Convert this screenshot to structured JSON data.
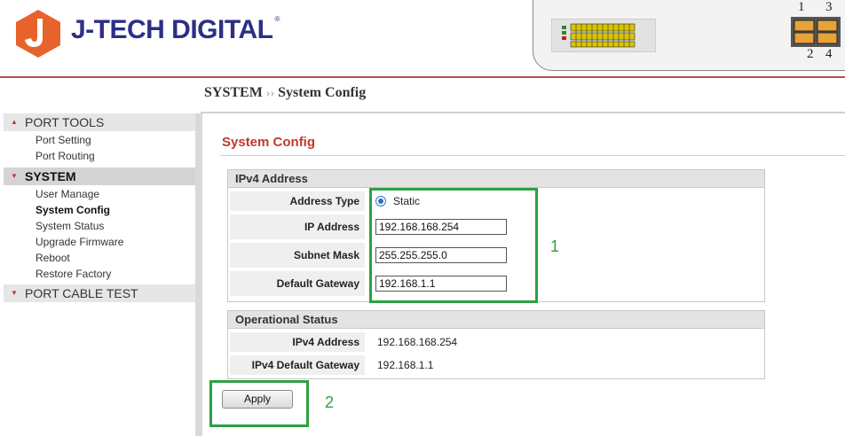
{
  "header": {
    "brand": "J-TECH DIGITAL",
    "trademark": "®",
    "port_numbers_top": [
      "1",
      "3"
    ],
    "port_numbers_bottom": [
      "2",
      "4"
    ]
  },
  "breadcrumb": {
    "section": "SYSTEM",
    "separator": "››",
    "page": "System Config"
  },
  "sidebar": {
    "sections": [
      {
        "label": "PORT TOOLS",
        "items": [
          "Port Setting",
          "Port Routing"
        ]
      },
      {
        "label": "SYSTEM",
        "items": [
          "User Manage",
          "System Config",
          "System Status",
          "Upgrade Firmware",
          "Reboot",
          "Restore Factory"
        ]
      },
      {
        "label": "PORT CABLE TEST",
        "items": []
      }
    ],
    "selected_item": "System Config"
  },
  "main": {
    "title": "System Config",
    "ipv4": {
      "heading": "IPv4 Address",
      "address_type_label": "Address Type",
      "address_type_value": "Static",
      "ip_label": "IP Address",
      "ip_value": "192.168.168.254",
      "mask_label": "Subnet Mask",
      "mask_value": "255.255.255.0",
      "gateway_label": "Default Gateway",
      "gateway_value": "192.168.1.1"
    },
    "status": {
      "heading": "Operational Status",
      "ipv4_label": "IPv4 Address",
      "ipv4_value": "192.168.168.254",
      "gateway_label": "IPv4 Default Gateway",
      "gateway_value": "192.168.1.1"
    },
    "apply_label": "Apply"
  },
  "annotations": {
    "box1": "1",
    "box2": "2"
  },
  "colors": {
    "brand": "#2b2f86",
    "logo": "#e8622c",
    "title": "#c0392b",
    "highlight": "#2ea043"
  }
}
